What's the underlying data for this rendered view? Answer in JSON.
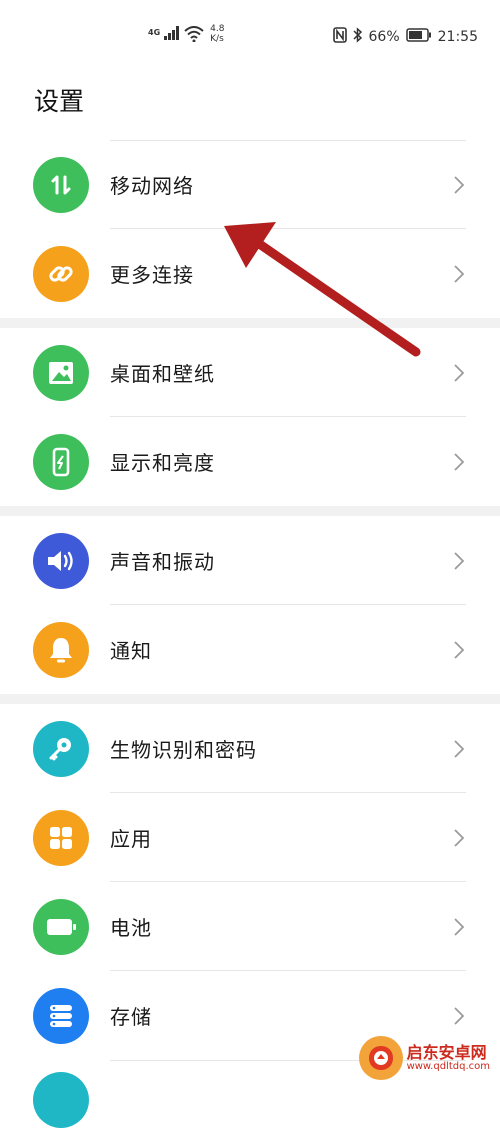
{
  "status_bar": {
    "network_type": "4G",
    "speed_value": "4.8",
    "speed_unit": "K/s",
    "battery": "66%",
    "time": "21:55"
  },
  "title": "设置",
  "groups": [
    [
      {
        "label": "移动网络",
        "icon": "arrows-updown-icon",
        "color": "#3fbf5b"
      },
      {
        "label": "更多连接",
        "icon": "link-icon",
        "color": "#f5a11b"
      }
    ],
    [
      {
        "label": "桌面和壁纸",
        "icon": "image-icon",
        "color": "#3fbf5b"
      },
      {
        "label": "显示和亮度",
        "icon": "phone-brightness-icon",
        "color": "#3fbf5b"
      }
    ],
    [
      {
        "label": "声音和振动",
        "icon": "speaker-icon",
        "color": "#3f5ad8"
      },
      {
        "label": "通知",
        "icon": "bell-icon",
        "color": "#f5a11b"
      }
    ],
    [
      {
        "label": "生物识别和密码",
        "icon": "key-icon",
        "color": "#1fb7c6"
      },
      {
        "label": "应用",
        "icon": "apps-grid-icon",
        "color": "#f5a11b"
      },
      {
        "label": "电池",
        "icon": "battery-icon",
        "color": "#3fbf5b"
      },
      {
        "label": "存储",
        "icon": "storage-icon",
        "color": "#1f7ff0"
      }
    ]
  ],
  "watermark": {
    "name": "启东安卓网",
    "url": "www.qdltdq.com"
  },
  "colors": {
    "annotation_arrow": "#b31e1e",
    "divider": "#e6e6e6",
    "group_gap": "#f1f1f1"
  }
}
